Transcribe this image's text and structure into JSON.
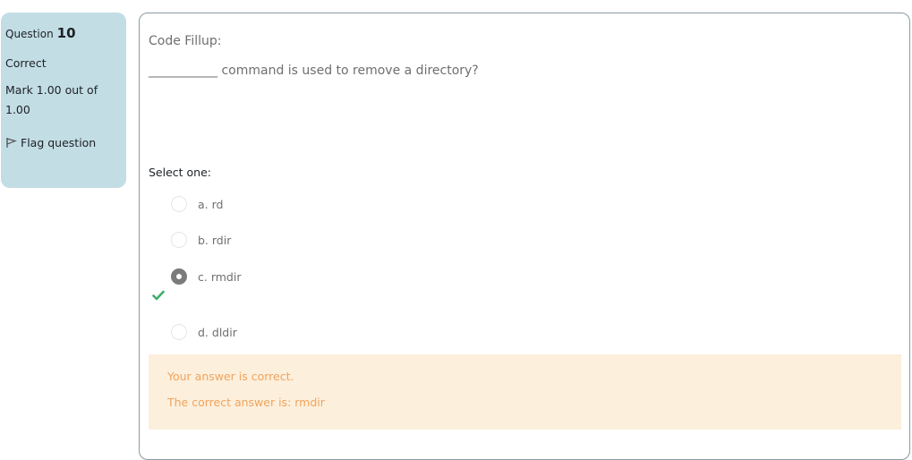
{
  "question_info": {
    "label": "Question",
    "number": "10",
    "state": "Correct",
    "grade": "Mark 1.00 out of 1.00",
    "flag_label": "Flag question",
    "flag_icon": "flag-icon"
  },
  "question": {
    "title": "Code Fillup:",
    "text": "___________ command is used to remove a directory?",
    "prompt": "Select one:",
    "options": [
      {
        "label": "a. rd",
        "selected": false
      },
      {
        "label": "b. rdir",
        "selected": false
      },
      {
        "label": "c. rmdir",
        "selected": true,
        "icon": "check-icon"
      },
      {
        "label": "d. dldir",
        "selected": false
      }
    ]
  },
  "feedback": {
    "result": "Your answer is correct.",
    "right_answer": "The correct answer is: rmdir"
  },
  "colors": {
    "info_bg": "#c3dde5",
    "feedback_bg": "#fcefdc",
    "feedback_text": "#f0a45d",
    "correct_tick": "#3fae6a"
  }
}
